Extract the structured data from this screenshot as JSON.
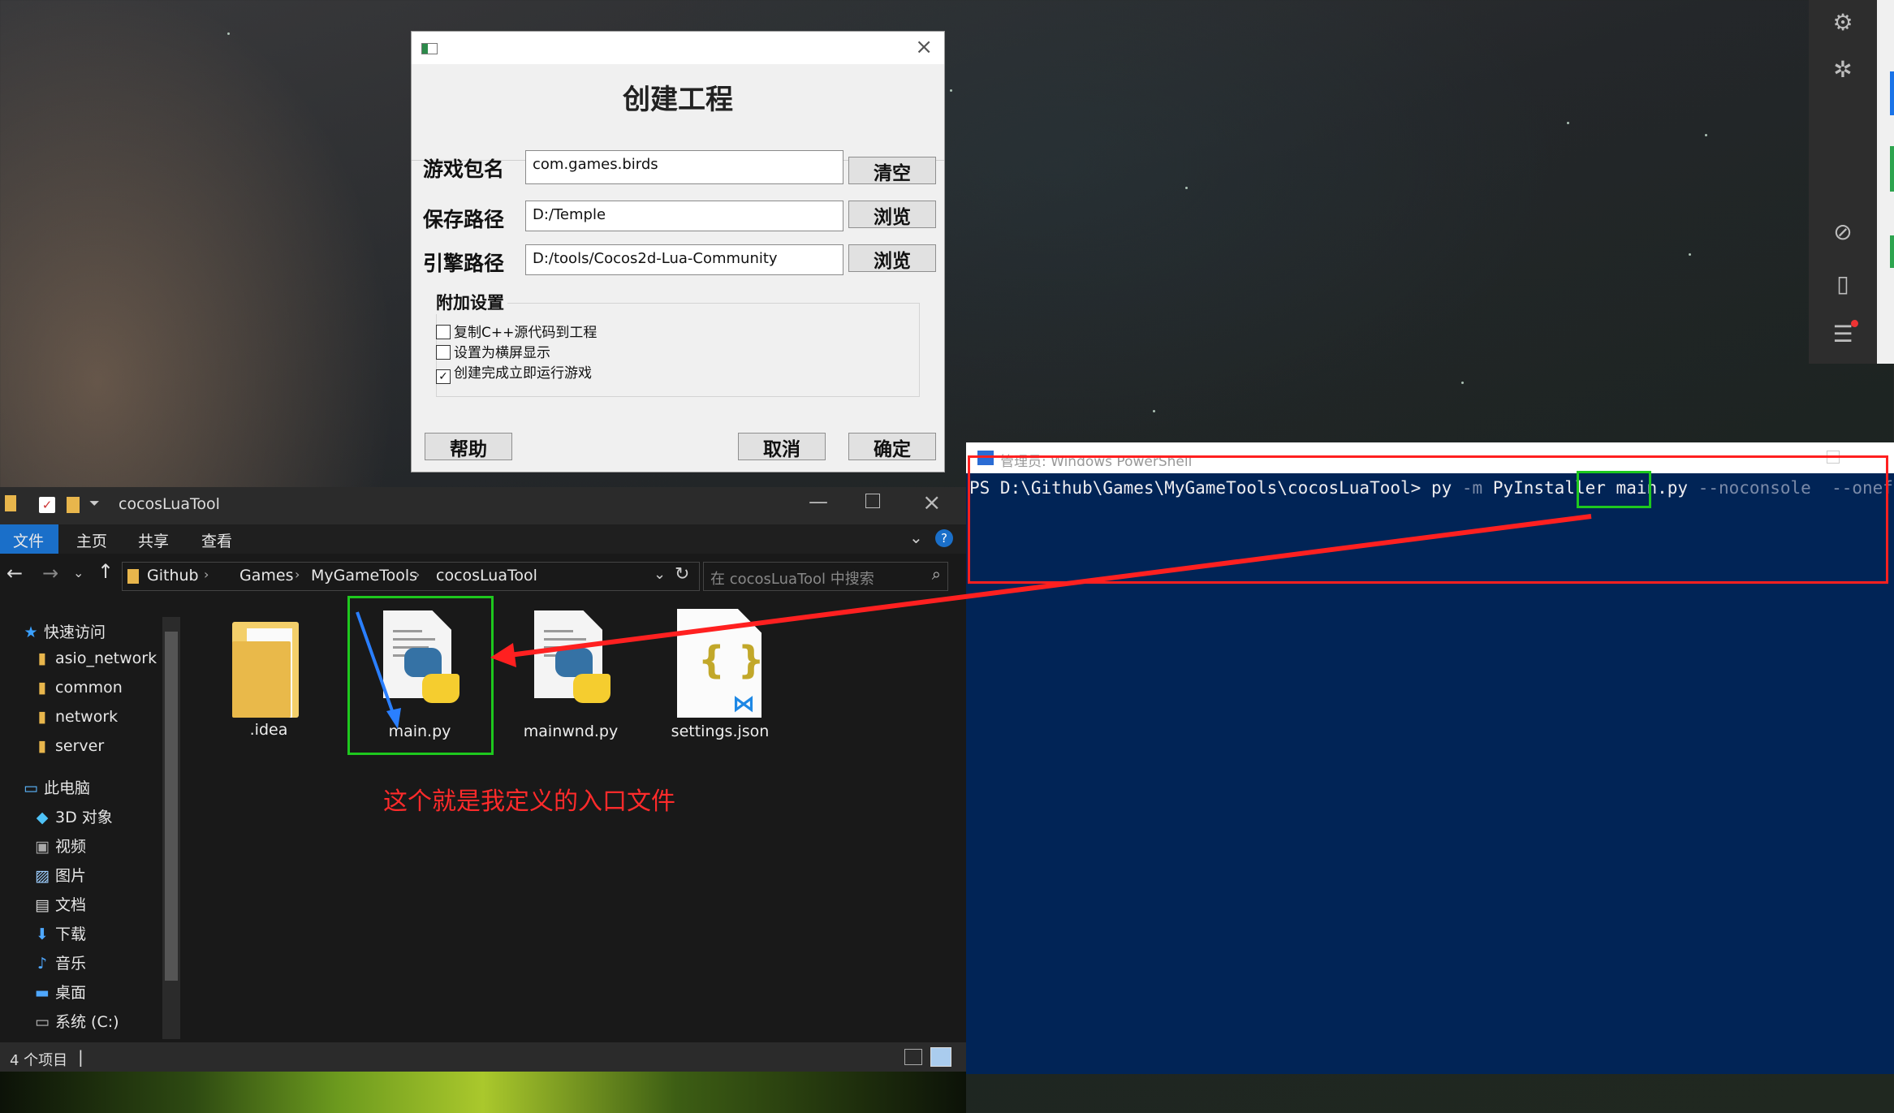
{
  "dialog": {
    "title": "创建工程",
    "rows": [
      {
        "label": "游戏包名",
        "value": "com.games.birds",
        "button": "清空"
      },
      {
        "label": "保存路径",
        "value": "D:/Temple",
        "button": "浏览"
      },
      {
        "label": "引擎路径",
        "value": "D:/tools/Cocos2d-Lua-Community",
        "button": "浏览"
      }
    ],
    "group_title": "附加设置",
    "checkboxes": [
      {
        "label": "复制C++源代码到工程",
        "checked": false
      },
      {
        "label": "设置为横屏显示",
        "checked": false
      },
      {
        "label": "创建完成立即运行游戏",
        "checked": true
      }
    ],
    "help": "帮助",
    "cancel": "取消",
    "ok": "确定"
  },
  "explorer": {
    "title": "cocosLuaTool",
    "ribbon": [
      "文件",
      "主页",
      "共享",
      "查看"
    ],
    "breadcrumb": [
      "Github",
      "Games",
      "MyGameTools",
      "cocosLuaTool"
    ],
    "search_placeholder": "在 cocosLuaTool 中搜索",
    "quick_access": "快速访问",
    "quick_items": [
      "asio_network",
      "common",
      "network",
      "server"
    ],
    "this_pc": "此电脑",
    "pc_items": [
      "3D 对象",
      "视频",
      "图片",
      "文档",
      "下载",
      "音乐",
      "桌面",
      "系统 (C:)"
    ],
    "files": [
      ".idea",
      "main.py",
      "mainwnd.py",
      "settings.json"
    ],
    "status": "4 个项目"
  },
  "powershell": {
    "title": "管理员: Windows PowerShell",
    "prompt": "PS D:\\Github\\Games\\MyGameTools\\cocosLuaTool> py ",
    "flag_m": "-m",
    "module": " PyInstaller ",
    "script": "main.py",
    "opts": " --noconsole  --onefile"
  },
  "annotation": "这个就是我定义的入口文件",
  "colors": {
    "annotation": "#ff2b2b",
    "highlight": "#1ec81e",
    "powershell_bg": "#012456"
  }
}
